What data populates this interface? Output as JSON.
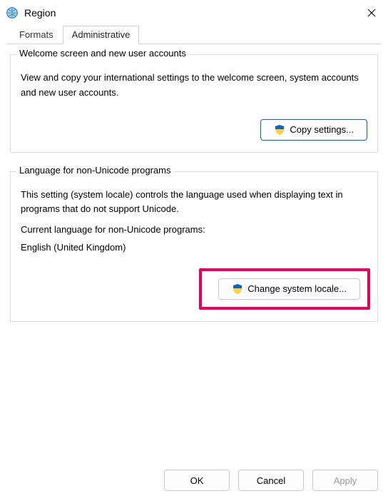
{
  "window": {
    "title": "Region"
  },
  "tabs": [
    {
      "label": "Formats",
      "active": false
    },
    {
      "label": "Administrative",
      "active": true
    }
  ],
  "group_welcome": {
    "title": "Welcome screen and new user accounts",
    "description": "View and copy your international settings to the welcome screen, system accounts and new user accounts.",
    "copy_button": "Copy settings..."
  },
  "group_locale": {
    "title": "Language for non-Unicode programs",
    "description": "This setting (system locale) controls the language used when displaying text in programs that do not support Unicode.",
    "current_label": "Current language for non-Unicode programs:",
    "current_value": "English (United Kingdom)",
    "change_button": "Change system locale..."
  },
  "buttons": {
    "ok": "OK",
    "cancel": "Cancel",
    "apply": "Apply"
  }
}
